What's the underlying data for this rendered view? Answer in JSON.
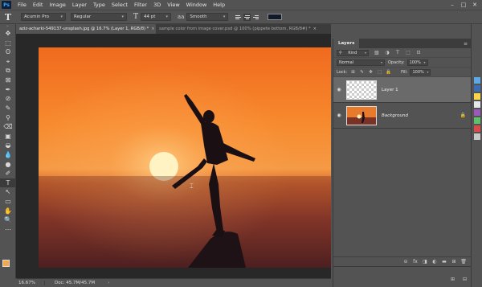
{
  "app": {
    "logo": "Ps"
  },
  "menu": [
    "File",
    "Edit",
    "Image",
    "Layer",
    "Type",
    "Select",
    "Filter",
    "3D",
    "View",
    "Window",
    "Help"
  ],
  "window_controls": {
    "minimize": "–",
    "maximize": "□",
    "close": "✕"
  },
  "options_bar": {
    "tool_glyph": "T",
    "font_family": "Acumin Pro",
    "font_style": "Regular",
    "size_glyph": "T",
    "font_size": "44 pt",
    "aa_label": "aa",
    "antialias": "Smooth",
    "text_color": "#121a2a"
  },
  "tabs": [
    {
      "label": "aziz-acharki-549137-unsplash.jpg @ 16.7% (Layer 1, RGB/8) *",
      "close": "×"
    },
    {
      "label": "sample color from image cover.psd @ 100% (pippete bottom, RGB/8#) *",
      "close": "×"
    }
  ],
  "tools": [
    "✥",
    "⬚",
    "ʘ",
    "⌖",
    "⧉",
    "⊠",
    "✒",
    "⊘",
    "✎",
    "⚲",
    "⌫",
    "▣",
    "◒",
    "💧",
    "●",
    "✐",
    "T",
    "↖",
    "▭",
    "✋",
    "🔍",
    "⋯"
  ],
  "colors": {
    "foreground": "#f5a74a",
    "background": "#ffffff"
  },
  "status": {
    "zoom": "16.67%",
    "doc": "Doc: 45.7M/45.7M",
    "caret": "›"
  },
  "layers_panel": {
    "title": "Layers",
    "menu_icon": "≡",
    "filter": "Kind",
    "filter_icons": [
      "▧",
      "◑",
      "T",
      "⬚",
      "⊡"
    ],
    "blend_mode": "Normal",
    "opacity_label": "Opacity:",
    "opacity": "100%",
    "lock_label": "Lock:",
    "lock_icons": [
      "⊞",
      "✎",
      "✥",
      "⬚",
      "🔒"
    ],
    "fill_label": "Fill:",
    "fill": "100%",
    "eye": "◉",
    "layers": [
      {
        "name": "Layer 1",
        "selected": true
      },
      {
        "name": "Background",
        "selected": false,
        "lock": "🔒"
      }
    ],
    "footer_icons": [
      "⊝",
      "fx",
      "◨",
      "◐",
      "▬",
      "⊞",
      "🗑"
    ]
  },
  "side_strip": {
    "top_icons": [
      "▣",
      "⊟"
    ],
    "swatches": [
      "#5ca8e8",
      "#3b6db5",
      "#ffd64a",
      "#e8e8e8",
      "#9a5ab8",
      "#5fbf6a",
      "#d94a4a",
      "#c8c8c8"
    ]
  }
}
